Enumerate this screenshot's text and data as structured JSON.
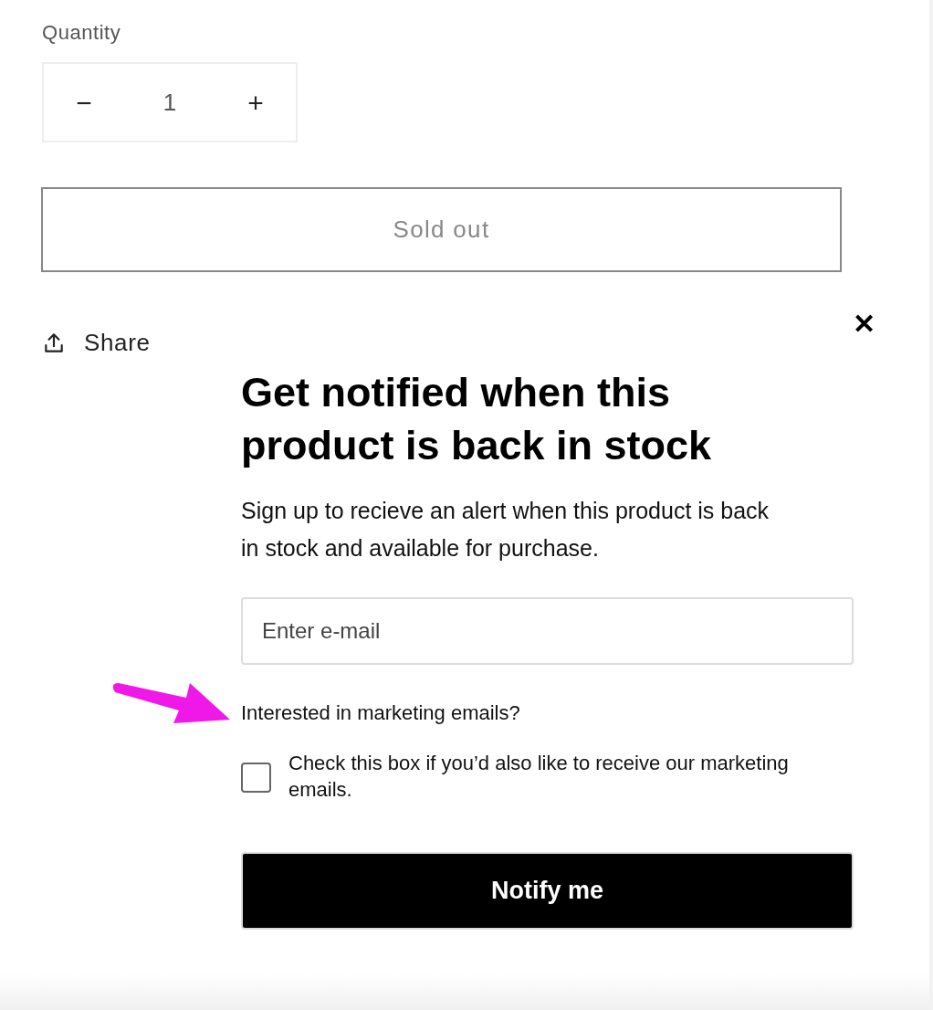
{
  "quantity": {
    "label": "Quantity",
    "decrement": "−",
    "value": "1",
    "increment": "+"
  },
  "sold_out_button": {
    "label": "Sold out",
    "disabled": true
  },
  "share": {
    "label": "Share"
  },
  "popup": {
    "close": "✕",
    "title": "Get notified when this product is back in stock",
    "description": "Sign up to recieve an alert when this product is back in stock and available for purchase.",
    "email": {
      "placeholder": "Enter e-mail"
    },
    "marketing_question": "Interested in marketing emails?",
    "marketing_checkbox": {
      "label": "Check this box if you’d also like to receive our marketing emails.",
      "checked": false
    },
    "submit": "Notify me"
  }
}
